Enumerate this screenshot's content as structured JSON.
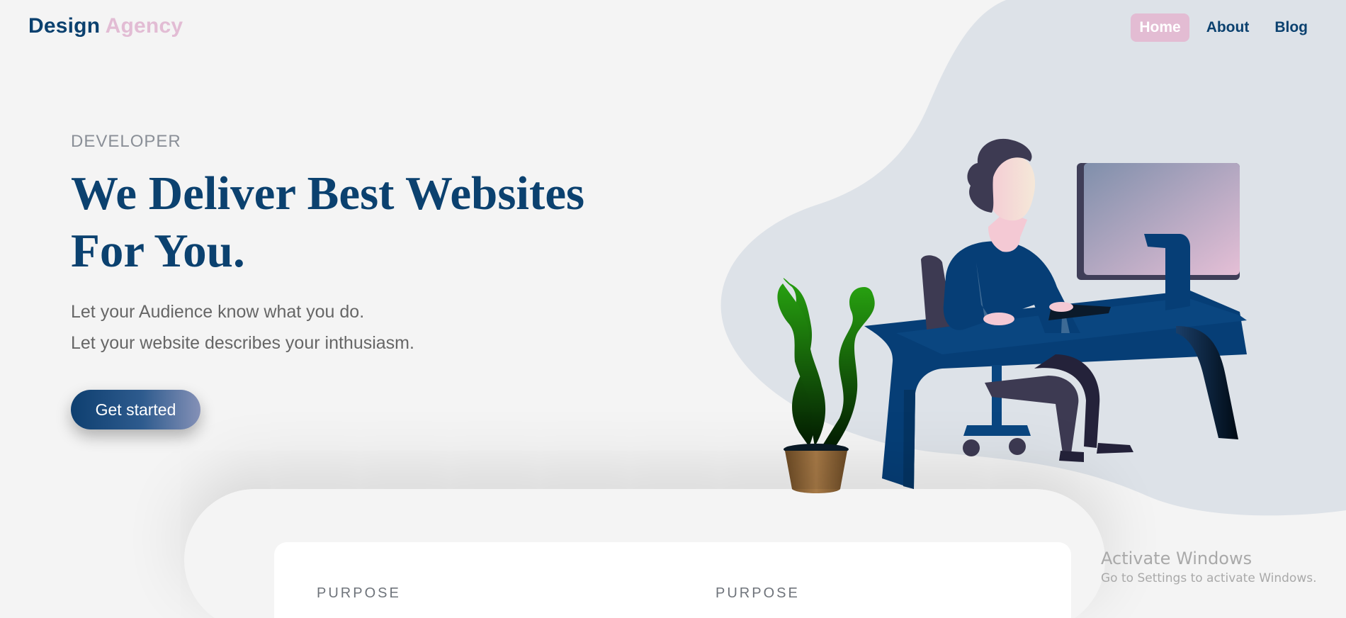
{
  "header": {
    "logo_primary": "Design",
    "logo_accent": "Agency",
    "nav": [
      {
        "label": "Home",
        "active": true
      },
      {
        "label": "About",
        "active": false
      },
      {
        "label": "Blog",
        "active": false
      }
    ]
  },
  "hero": {
    "eyebrow": "DEVELOPER",
    "headline_line1": "We Deliver Best Websites",
    "headline_line2": "For You.",
    "subtext_line1": "Let your Audience know what you do.",
    "subtext_line2": "Let your website describes your inthusiasm.",
    "cta_label": "Get started"
  },
  "features": {
    "items": [
      {
        "label": "PURPOSE"
      },
      {
        "label": "PURPOSE"
      }
    ]
  },
  "watermark": {
    "title": "Activate Windows",
    "subtitle": "Go to Settings to activate Windows."
  },
  "colors": {
    "brand_navy": "#0b416f",
    "accent_pink": "#e3bcd3",
    "background": "#f4f4f4",
    "blob": "#dde2e8"
  },
  "illustration": {
    "icons": [
      "person-at-desk-illustration",
      "plant-icon",
      "monitor-icon",
      "office-chair-icon",
      "desk-icon"
    ]
  }
}
